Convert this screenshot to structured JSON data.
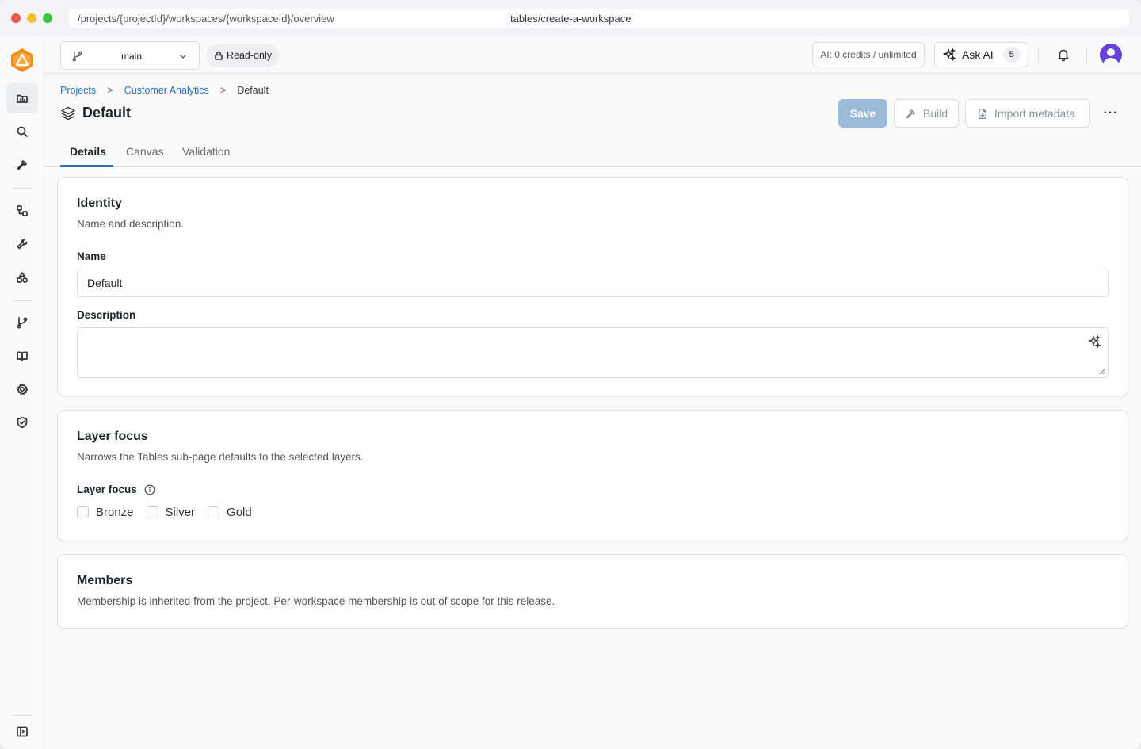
{
  "browser": {
    "url_path": "/projects/{projectId}/workspaces/{workspaceId}/overview",
    "url_center": "tables/create-a-workspace"
  },
  "header": {
    "branch_name": "main",
    "readonly_label": "Read-only",
    "credits_label": "AI: 0 credits / unlimited",
    "ask_ai_label": "Ask AI",
    "ask_ai_count": "5"
  },
  "breadcrumb": {
    "items": [
      "Projects",
      "Customer Analytics"
    ],
    "current": "Default",
    "separator": ">"
  },
  "page": {
    "title": "Default",
    "save_label": "Save",
    "build_label": "Build",
    "import_label": "Import metadata",
    "more_label": "···"
  },
  "tabs": [
    "Details",
    "Canvas",
    "Validation"
  ],
  "identity": {
    "title": "Identity",
    "description": "Name and description.",
    "name_label": "Name",
    "name_value": "Default",
    "description_label": "Description"
  },
  "layer_focus": {
    "title": "Layer focus",
    "description": "Narrows the Tables sub-page defaults to the selected layers.",
    "field_label": "Layer focus",
    "options": [
      "Bronze",
      "Silver",
      "Gold"
    ]
  },
  "members": {
    "title": "Members",
    "description": "Membership is inherited from the project. Per-workspace membership is out of scope for this release."
  },
  "colors": {
    "accent": "#2f6db5",
    "save_disabled": "#9bbbd9",
    "logo": "#f08c1a",
    "avatar": "#6741d9"
  }
}
